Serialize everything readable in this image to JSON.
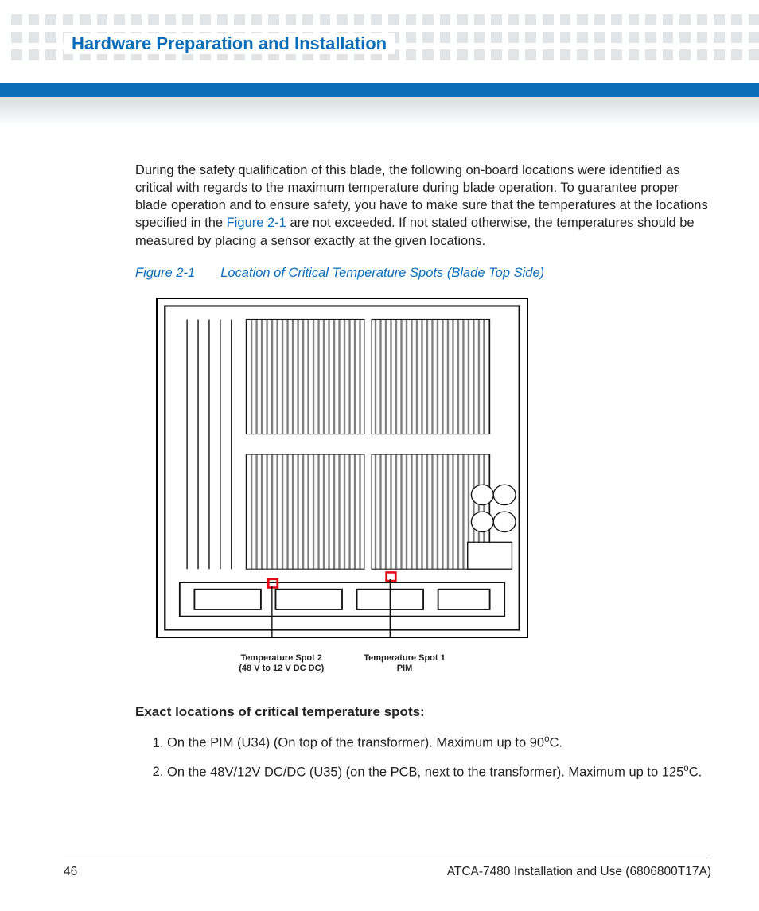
{
  "header": {
    "title": "Hardware Preparation and Installation"
  },
  "body": {
    "intro_before_link": "During the safety qualification of this blade, the following on-board locations were identified as critical with regards to the maximum temperature during blade operation. To guarantee proper blade operation and to ensure safety, you have to make sure that the temperatures at the locations specified in the ",
    "intro_link": "Figure 2-1",
    "intro_after_link": " are not exceeded. If not stated otherwise, the temperatures should be measured by placing a sensor exactly at the given locations."
  },
  "figure": {
    "number": "Figure 2-1",
    "title": "Location of Critical Temperature Spots (Blade Top Side)",
    "spot2_line1": "Temperature Spot 2",
    "spot2_line2": "(48 V to 12 V DC DC)",
    "spot1_line1": "Temperature Spot 1",
    "spot1_line2": "PIM"
  },
  "locations": {
    "heading": "Exact locations of critical temperature spots:",
    "item1_a": "On the PIM (U34) (On top of the transformer). Maximum up to 90",
    "item1_b": "C.",
    "item2_a": "On the 48V/12V DC/DC (U35) (on the PCB, next to the transformer). Maximum up to 125",
    "item2_b": "C.",
    "deg": "o"
  },
  "footer": {
    "page": "46",
    "doc": "ATCA-7480 Installation and Use (6806800T17A)"
  }
}
